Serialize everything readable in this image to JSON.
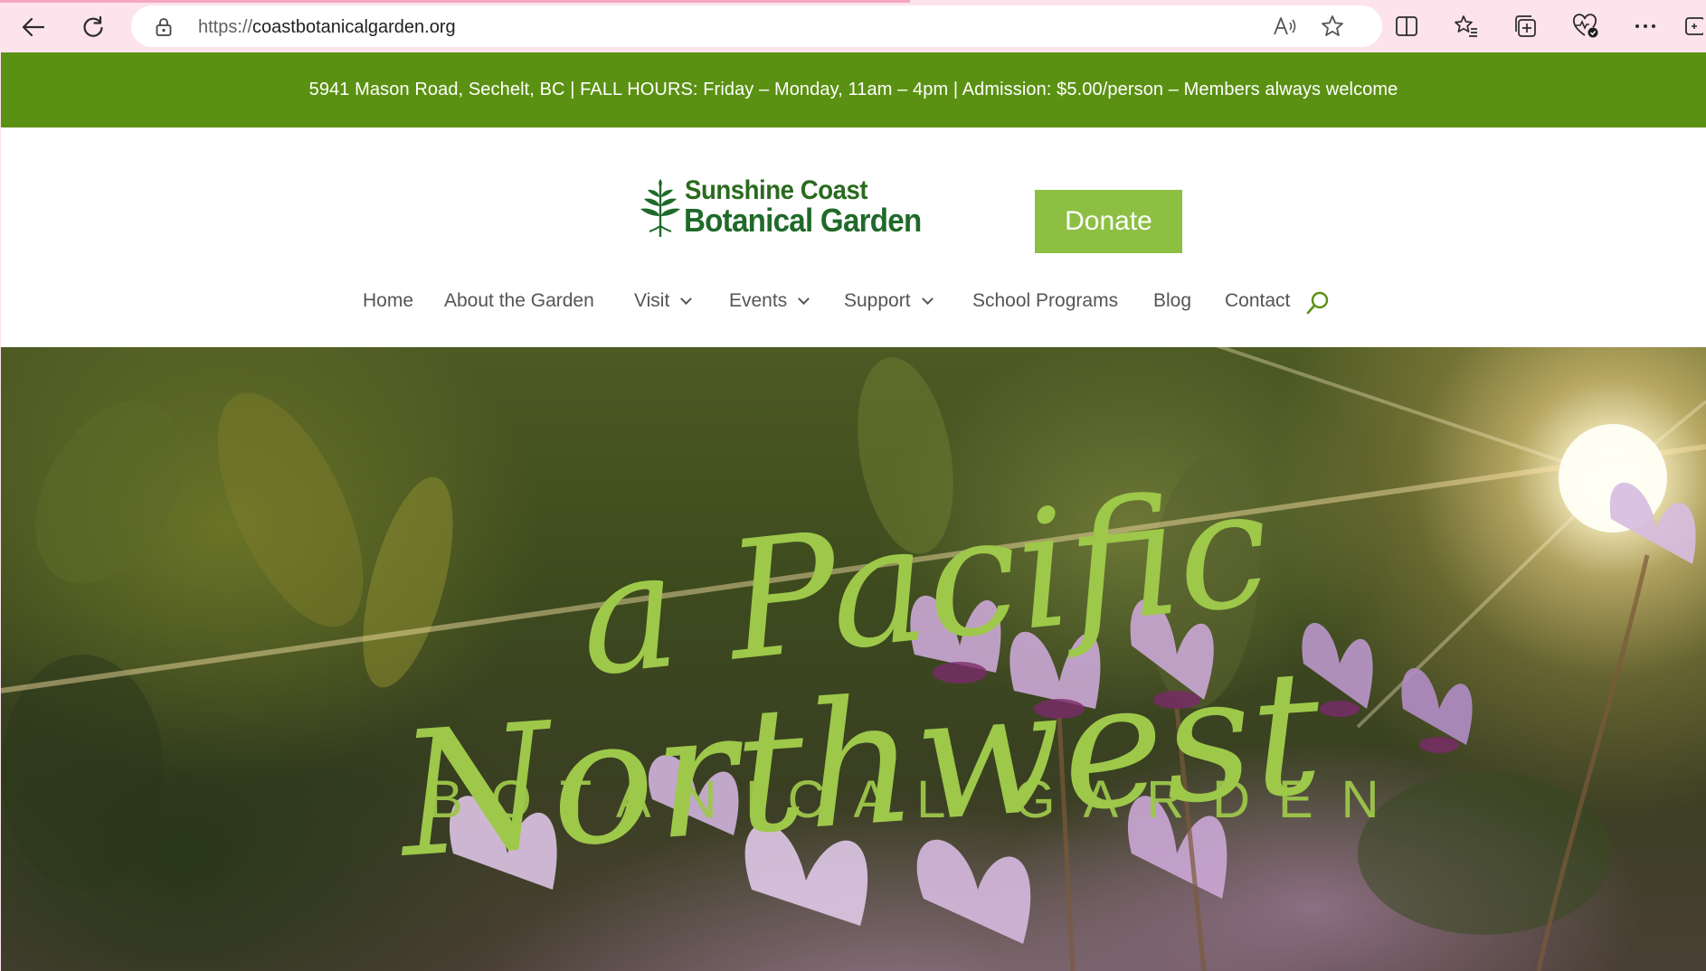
{
  "browser": {
    "url_protocol": "https://",
    "url_host": "coastbotanicalgarden.org"
  },
  "topbar": {
    "info": "5941 Mason Road, Sechelt, BC  |  FALL HOURS: Friday – Monday, 11am – 4pm  |  Admission: $5.00/person – Members always welcome"
  },
  "header": {
    "logo_line1": "Sunshine Coast",
    "logo_line2": "Botanical Garden",
    "donate_label": "Donate"
  },
  "nav": {
    "items": [
      {
        "label": "Home"
      },
      {
        "label": "About the Garden"
      },
      {
        "label": "Visit"
      },
      {
        "label": "Events"
      },
      {
        "label": "Support"
      },
      {
        "label": "School Programs"
      },
      {
        "label": "Blog"
      },
      {
        "label": "Contact"
      }
    ]
  },
  "hero": {
    "script_line1": "a Pacific",
    "script_line2": "Northwest",
    "subtitle": "BOTANICAL GARDEN"
  },
  "colors": {
    "topbar_bg": "#5b9113",
    "donate_bg": "#8dbf42",
    "hero_text": "#9dc84a",
    "chrome_bg": "#fde3ec"
  }
}
